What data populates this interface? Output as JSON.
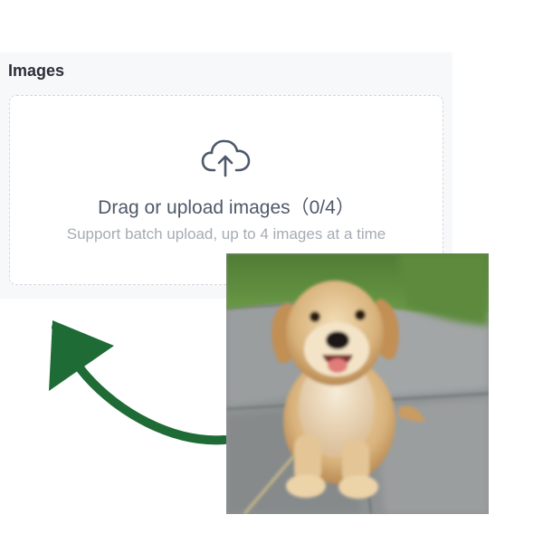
{
  "uploader": {
    "section_title": "Images",
    "title": "Drag or upload images（0/4）",
    "hint": "Support batch upload, up to 4 images at a time",
    "icon": "cloud-upload-icon",
    "count": 0,
    "max": 4
  },
  "annotation": {
    "arrow_color": "#1e6b35",
    "photo_subject": "golden-retriever-puppy"
  }
}
